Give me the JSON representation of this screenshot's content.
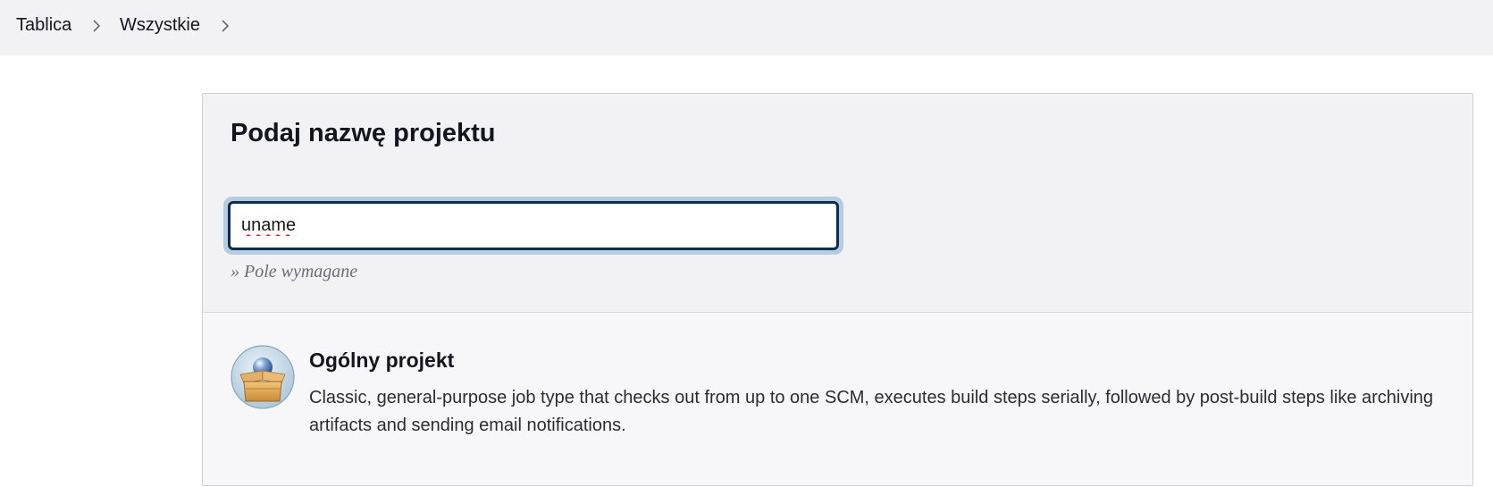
{
  "breadcrumb": {
    "items": [
      {
        "label": "Tablica"
      },
      {
        "label": "Wszystkie"
      }
    ]
  },
  "form": {
    "title": "Podaj nazwę projektu",
    "name_value": "uname",
    "required_hint": "» Pole wymagane"
  },
  "job_types": [
    {
      "title": "Ogólny projekt",
      "description": "Classic, general-purpose job type that checks out from up to one SCM, executes build steps serially, followed by post-build steps like archiving artifacts and sending email notifications.",
      "icon": "freestyle-project-icon"
    }
  ],
  "colors": {
    "breadcrumb_bg": "#f2f2f5",
    "input_focus_border": "#0d2f4d",
    "input_focus_ring": "#b6cde0"
  }
}
